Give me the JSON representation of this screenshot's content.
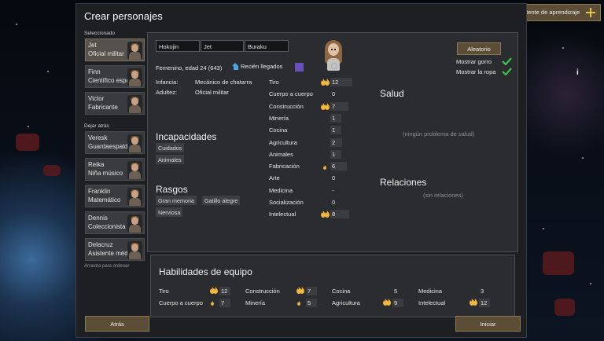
{
  "window": {
    "title": "Crear personajes"
  },
  "learning_helper": {
    "label": "Asistente de aprendizaje"
  },
  "sidebar": {
    "selected_title": "Seleccionado",
    "left_behind_title": "Dejar atrás",
    "drag_hint": "Arrastra para ordenar",
    "selected": [
      {
        "name": "Jet",
        "role": "Oficial militar"
      },
      {
        "name": "Finn",
        "role": "Científico espacial"
      },
      {
        "name": "Victor",
        "role": "Fabricante"
      }
    ],
    "left_behind": [
      {
        "name": "Veresk",
        "role": "Guardaespalda"
      },
      {
        "name": "Reika",
        "role": "Niña músico"
      },
      {
        "name": "Franklin",
        "role": "Matemático"
      },
      {
        "name": "Dennis",
        "role": "Coleccionista"
      },
      {
        "name": "Delacruz",
        "role": "Asistente médico"
      }
    ]
  },
  "character": {
    "first_name": "Hokojin",
    "nick_name": "Jet",
    "last_name": "Buraku",
    "summary": "Femenino, edad 24 (643)",
    "arrival": "Recién llegados",
    "favorite_color": "#6a4fc0",
    "childhood_label": "Infancia:",
    "childhood": "Mecánico de chatarra",
    "adulthood_label": "Adultez:",
    "adulthood": "Oficial militar",
    "incapable_title": "Incapacidades",
    "incapable": [
      "Cuidados",
      "Animales"
    ],
    "traits_title": "Rasgos",
    "traits": [
      "Gran memoria",
      "Gatillo alegre",
      "Nerviosa"
    ]
  },
  "skills": [
    {
      "name": "Tiro",
      "value": "12",
      "passion": 2
    },
    {
      "name": "Cuerpo a cuerpo",
      "value": "0",
      "passion": 0
    },
    {
      "name": "Construcción",
      "value": "7",
      "passion": 2
    },
    {
      "name": "Minería",
      "value": "1",
      "passion": 0
    },
    {
      "name": "Cocina",
      "value": "1",
      "passion": 0
    },
    {
      "name": "Agricultura",
      "value": "2",
      "passion": 0
    },
    {
      "name": "Animales",
      "value": "1",
      "passion": 0
    },
    {
      "name": "Fabricación",
      "value": "6",
      "passion": 1
    },
    {
      "name": "Arte",
      "value": "0",
      "passion": 0
    },
    {
      "name": "Medicina",
      "value": "-",
      "passion": 0
    },
    {
      "name": "Socialización",
      "value": "0",
      "passion": 0
    },
    {
      "name": "Intelectual",
      "value": "8",
      "passion": 2
    }
  ],
  "randomize": {
    "label": "Aleatorio"
  },
  "toggles": [
    {
      "label": "Mostrar gorro",
      "checked": true
    },
    {
      "label": "Mostrar la ropa",
      "checked": true
    }
  ],
  "health": {
    "title": "Salud",
    "empty": "(ningún problema de salud)"
  },
  "relations": {
    "title": "Relaciones",
    "empty": "(sin relaciones)"
  },
  "team": {
    "title": "Habilidades de equipo",
    "skills": [
      {
        "name": "Tiro",
        "value": "12",
        "passion": 2
      },
      {
        "name": "Cuerpo a cuerpo",
        "value": "7",
        "passion": 1
      },
      {
        "name": "Construcción",
        "value": "7",
        "passion": 2
      },
      {
        "name": "Minería",
        "value": "5",
        "passion": 1
      },
      {
        "name": "Cocina",
        "value": "5",
        "passion": 0
      },
      {
        "name": "Agricultura",
        "value": "9",
        "passion": 2
      },
      {
        "name": "Medicina",
        "value": "3",
        "passion": 0
      },
      {
        "name": "Intelectual",
        "value": "12",
        "passion": 2
      }
    ]
  },
  "buttons": {
    "back": "Atrás",
    "start": "Iniciar"
  },
  "colors": {
    "accent": "#8c7a55",
    "passion": "#f2b63a",
    "check": "#3bc24a"
  }
}
